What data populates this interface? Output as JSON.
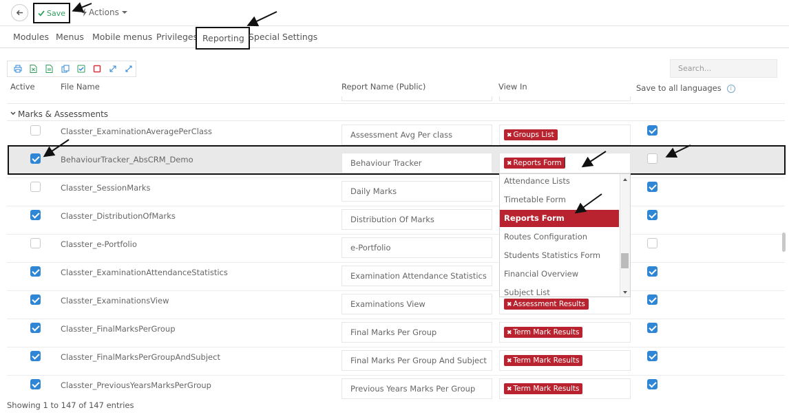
{
  "toolbar": {
    "save_label": "Save",
    "actions_label": "Actions"
  },
  "tabs": [
    "Modules",
    "Menus",
    "Mobile menus",
    "Privileges",
    "Reporting",
    "Special Settings"
  ],
  "search": {
    "placeholder": "Search..."
  },
  "columns": {
    "active": "Active",
    "file_name": "File Name",
    "report_name": "Report Name (Public)",
    "view_in": "View In",
    "save_all": "Save to all languages"
  },
  "group": "Marks & Assessments",
  "rows": [
    {
      "active": false,
      "file": "Classter_ExaminationAveragePerClass",
      "report": "Assessment Avg Per class",
      "view_in": "Groups List",
      "save_all": true
    },
    {
      "active": true,
      "file": "BehaviourTracker_AbsCRM_Demo",
      "report": "Behaviour Tracker",
      "view_in": "Reports Form",
      "save_all": false
    },
    {
      "active": false,
      "file": "Classter_SessionMarks",
      "report": "Daily Marks",
      "view_in": "",
      "save_all": true
    },
    {
      "active": true,
      "file": "Classter_DistributionOfMarks",
      "report": "Distribution Of Marks",
      "view_in": "",
      "save_all": true
    },
    {
      "active": false,
      "file": "Classter_e-Portfolio",
      "report": "e-Portfolio",
      "view_in": "",
      "save_all": false
    },
    {
      "active": true,
      "file": "Classter_ExaminationAttendanceStatistics",
      "report": "Examination Attendance Statistics",
      "view_in": "",
      "save_all": true
    },
    {
      "active": true,
      "file": "Classter_ExaminationsView",
      "report": "Examinations View",
      "view_in": "Assessment Results",
      "save_all": true
    },
    {
      "active": true,
      "file": "Classter_FinalMarksPerGroup",
      "report": "Final Marks Per Group",
      "view_in": "Term Mark Results",
      "save_all": true
    },
    {
      "active": true,
      "file": "Classter_FinalMarksPerGroupAndSubject",
      "report": "Final Marks Per Group And Subject",
      "view_in": "Term Mark Results",
      "save_all": true
    },
    {
      "active": true,
      "file": "Classter_PreviousYearsMarksPerGroup",
      "report": "Previous Years Marks Per Group",
      "view_in": "Term Mark Results",
      "save_all": true
    }
  ],
  "dropdown": {
    "options": [
      "Attendance Lists",
      "Timetable Form",
      "Reports Form",
      "Routes Configuration",
      "Students Statistics Form",
      "Financial Overview",
      "Subject List"
    ],
    "selected": "Reports Form"
  },
  "footer": {
    "entries": "Showing 1 to 147 of 147 entries"
  },
  "colors": {
    "accent_red": "#b8232f",
    "checkbox_blue": "#2f86d4",
    "save_green": "#2e9e5b"
  }
}
